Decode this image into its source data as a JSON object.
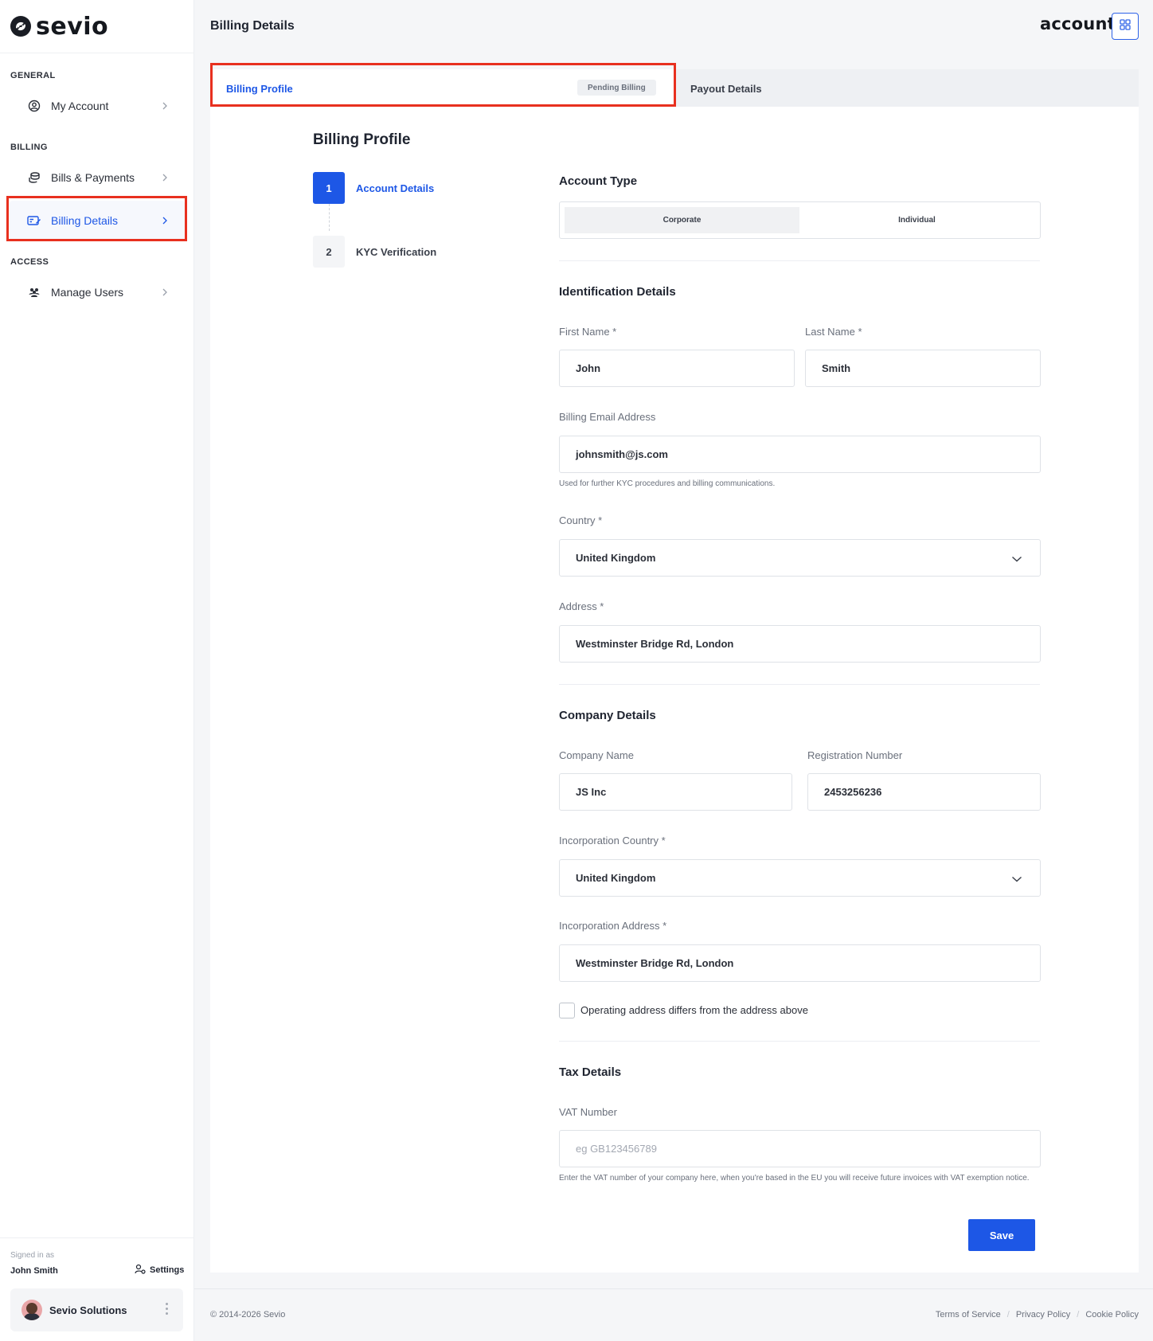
{
  "app": {
    "brand": "sevio",
    "page_title": "Billing Details",
    "account_brand": "account"
  },
  "sidebar": {
    "sections": [
      {
        "title": "GENERAL",
        "items": [
          {
            "label": "My Account",
            "icon": "user-circle-icon"
          }
        ]
      },
      {
        "title": "BILLING",
        "items": [
          {
            "label": "Bills & Payments",
            "icon": "coins-icon"
          },
          {
            "label": "Billing Details",
            "icon": "billing-card-icon",
            "active": true
          }
        ]
      },
      {
        "title": "ACCESS",
        "items": [
          {
            "label": "Manage Users",
            "icon": "users-icon"
          }
        ]
      }
    ],
    "signed_in_label": "Signed in as",
    "user_name": "John Smith",
    "settings_label": "Settings",
    "org_name": "Sevio Solutions"
  },
  "tabs": [
    {
      "label": "Billing Profile",
      "badge": "Pending Billing",
      "active": true
    },
    {
      "label": "Payout Details",
      "active": false
    }
  ],
  "content": {
    "title": "Billing Profile",
    "steps": [
      {
        "num": "1",
        "label": "Account Details",
        "active": true
      },
      {
        "num": "2",
        "label": "KYC Verification",
        "active": false
      }
    ],
    "account_type": {
      "heading": "Account Type",
      "options": [
        "Corporate",
        "Individual"
      ],
      "selected": "Corporate"
    },
    "identification": {
      "heading": "Identification Details",
      "first_name_label": "First Name *",
      "first_name": "John",
      "last_name_label": "Last Name *",
      "last_name": "Smith",
      "email_label": "Billing Email Address",
      "email": "johnsmith@js.com",
      "email_help": "Used for further KYC procedures and billing communications.",
      "country_label": "Country *",
      "country": "United Kingdom",
      "address_label": "Address *",
      "address": "Westminster Bridge Rd, London"
    },
    "company": {
      "heading": "Company Details",
      "name_label": "Company Name",
      "name": "JS Inc",
      "reg_label": "Registration Number",
      "reg": "2453256236",
      "inc_country_label": "Incorporation Country *",
      "inc_country": "United Kingdom",
      "inc_address_label": "Incorporation Address *",
      "inc_address": "Westminster Bridge Rd, London",
      "operating_checkbox_label": "Operating address differs from the address above",
      "operating_checked": false
    },
    "tax": {
      "heading": "Tax Details",
      "vat_label": "VAT Number",
      "vat_placeholder": "eg GB123456789",
      "vat_help": "Enter the VAT number of your company here, when you're based in the EU you will receive future invoices with VAT exemption notice."
    },
    "save_label": "Save"
  },
  "footer": {
    "copyright": "© 2014-2026 Sevio",
    "links": [
      "Terms of Service",
      "Privacy Policy",
      "Cookie Policy"
    ]
  },
  "colors": {
    "accent": "#1d57e6",
    "highlight": "#e8301f",
    "text": "#1f2430",
    "muted": "#6a707c"
  }
}
